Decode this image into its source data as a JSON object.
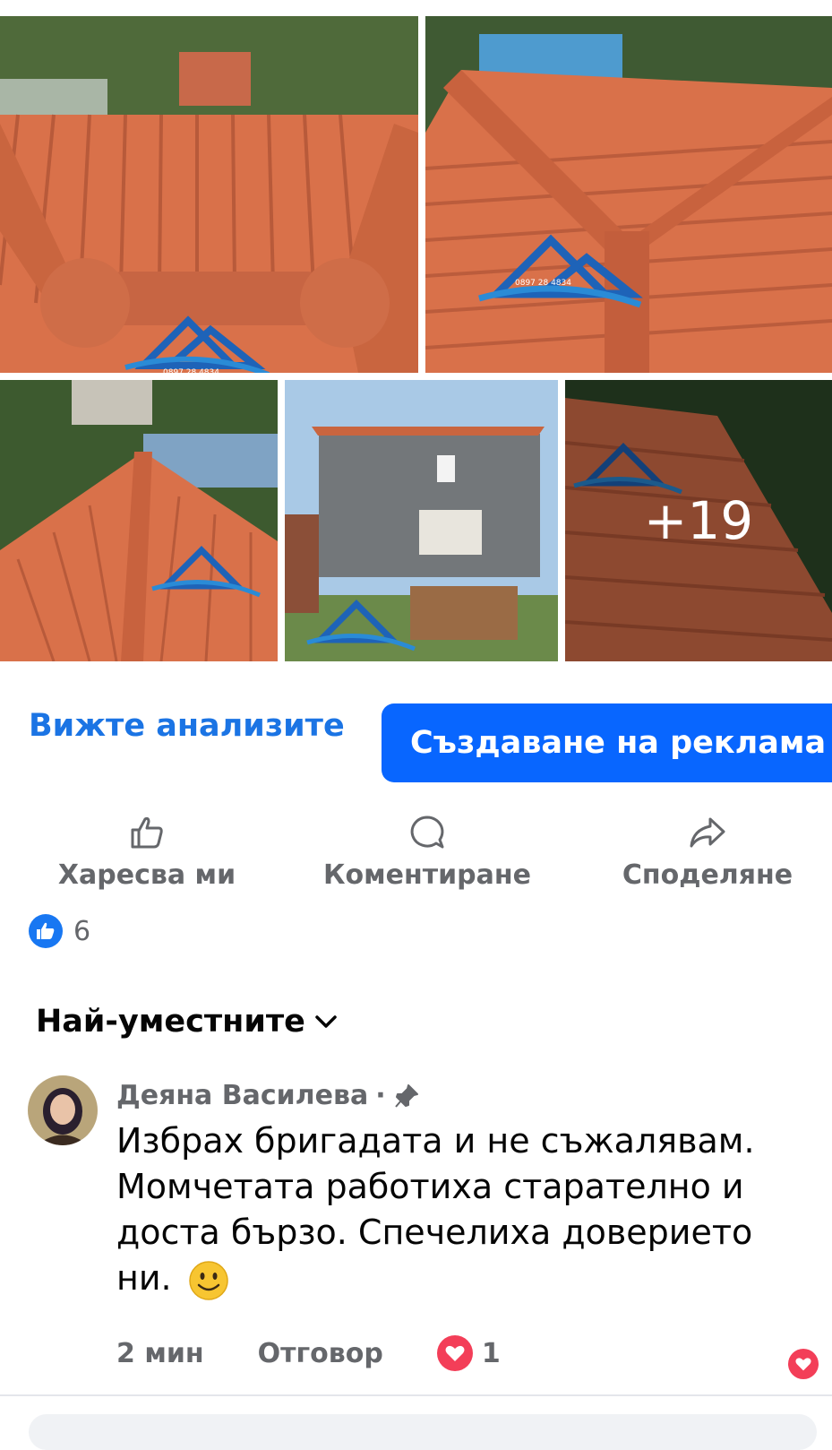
{
  "gallery": {
    "watermark_phone": "0897 28 4834",
    "more_count": "+19"
  },
  "post_actions": {
    "insights_label": "Вижте анализите",
    "boost_label": "Създаване на реклама"
  },
  "actions": {
    "like_label": "Харесва ми",
    "comment_label": "Коментиране",
    "share_label": "Споделяне"
  },
  "reactions": {
    "count": "6"
  },
  "comments_sort": {
    "label": "Най-уместните"
  },
  "comment": {
    "author": "Деяна Василева",
    "separator": "·",
    "text": "Избрах бригадата и не съжалявам. Момчетата работиха старателно и доста бързо. Спечелиха доверието ни.",
    "time": "2 мин",
    "reply_label": "Отговор",
    "love_count": "1"
  },
  "colors": {
    "accent": "#0866ff",
    "link": "#1b74e4",
    "love": "#f33e58",
    "roof": "#d9714a"
  }
}
